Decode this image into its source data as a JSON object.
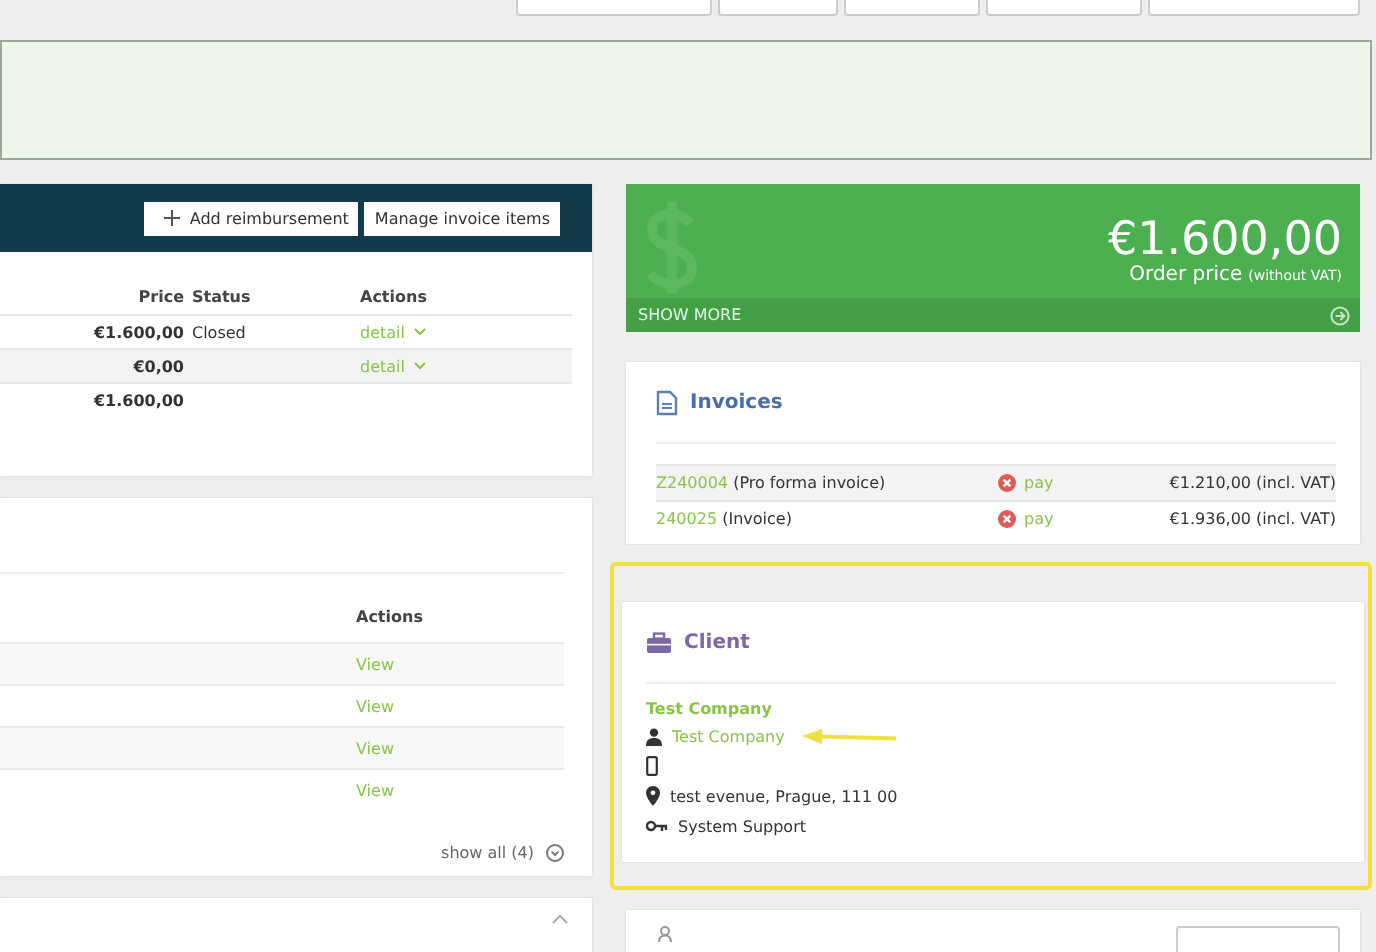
{
  "items_panel": {
    "buttons": [
      {
        "kind": "add",
        "label": "Add reimbursement"
      },
      {
        "label": "Manage invoice items"
      }
    ],
    "columns": [
      "Price",
      "Status",
      "Actions"
    ],
    "rows": [
      {
        "price": "€1.600,00",
        "status": "Closed",
        "action": "detail"
      },
      {
        "price": "€0,00",
        "status": "",
        "action": "detail"
      }
    ],
    "total": "€1.600,00"
  },
  "list_panel": {
    "column": "Actions",
    "rows": [
      "View",
      "View",
      "View",
      "View"
    ],
    "show_all": "show all (4)"
  },
  "order_price": {
    "amount": "€1.600,00",
    "label": "Order price",
    "note": "(without VAT)",
    "show_more": "SHOW MORE"
  },
  "invoices": {
    "title": "Invoices",
    "rows": [
      {
        "number": "Z240004",
        "type": "(Pro forma invoice)",
        "status": "pay",
        "amount": "€1.210,00 (incl. VAT)"
      },
      {
        "number": "240025",
        "type": "(Invoice)",
        "status": "pay",
        "amount": "€1.936,00 (incl. VAT)"
      }
    ]
  },
  "client": {
    "title": "Client",
    "company": "Test Company",
    "contact": "Test Company",
    "address": "test evenue, Prague, 111 00",
    "owner": "System Support"
  }
}
